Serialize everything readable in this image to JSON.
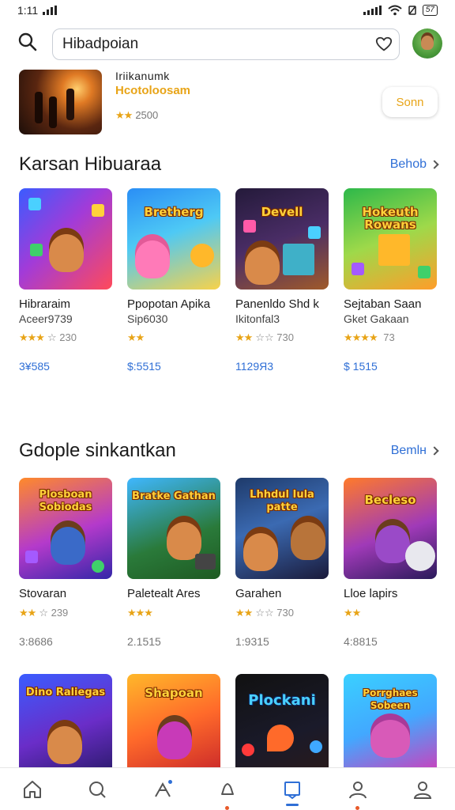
{
  "status_bar": {
    "time": "1:11",
    "battery": "57"
  },
  "search": {
    "value": "Hibadpoian"
  },
  "top_card": {
    "title": "Iriikanumk",
    "subtitle": "Hcotoloosam",
    "stars": "★★",
    "rating": "2500",
    "button_label": "Sonn"
  },
  "sections": [
    {
      "title": "Karsan Hibuaraa",
      "link": "Behob",
      "items": [
        {
          "logo": "",
          "name": "Hibraraim",
          "sub": "Aceer9739",
          "stars": "★★★",
          "empty_stars": "☆",
          "rating": "230",
          "price": "3¥585",
          "price_style": "blue"
        },
        {
          "logo": "Bretherg",
          "name": "Ppopotan Apika",
          "sub": "Sip6030",
          "stars": "★★",
          "empty_stars": "",
          "rating": "",
          "price": "$:5515",
          "price_style": "blue"
        },
        {
          "logo": "Devell",
          "name": "Panenldo Shd k",
          "sub": "Ikitonfal3",
          "stars": "★★",
          "empty_stars": "☆☆",
          "rating": "730",
          "price": "1129Я3",
          "price_style": "blue"
        },
        {
          "logo": "Hokeuth Rowans",
          "name": "Sejtaban Saan",
          "sub": "Gket Gakaan",
          "stars": "★★★★",
          "empty_stars": "",
          "rating": "73",
          "price": "$ 1515",
          "price_style": "blue"
        }
      ]
    },
    {
      "title": "Gdople sinkantkan",
      "link": "Bemlн",
      "items": [
        {
          "logo": "Plosboan Sobiodas",
          "name": "Stovaran",
          "sub": "",
          "stars": "★★",
          "empty_stars": "☆",
          "rating": "239",
          "price": "3:8686",
          "price_style": "gray"
        },
        {
          "logo": "Bratke Gathan",
          "name": "Paletealt Ares",
          "sub": "",
          "stars": "★★★",
          "empty_stars": "",
          "rating": "",
          "price": "2.1515",
          "price_style": "gray"
        },
        {
          "logo": "Lhhdul Iula patte",
          "name": "Garahen",
          "sub": "",
          "stars": "★★",
          "empty_stars": "☆☆",
          "rating": "730",
          "price": "1:9315",
          "price_style": "gray"
        },
        {
          "logo": "Becleso",
          "name": "Lloe lapirs",
          "sub": "",
          "stars": "★★",
          "empty_stars": "",
          "rating": "",
          "price": "4:8815",
          "price_style": "gray"
        }
      ]
    },
    {
      "items": [
        {
          "logo": "Dino Raliegas"
        },
        {
          "logo": "Shapoan"
        },
        {
          "logo": "Plockani"
        },
        {
          "logo": "Porrghaes Sobeen"
        }
      ]
    }
  ],
  "colors": {
    "accent": "#2f6fd6",
    "star": "#e8a417",
    "notify": "#e85a2a"
  },
  "bottom_nav": [
    "home-icon",
    "search-icon",
    "games-icon",
    "bell-icon",
    "library-icon",
    "profile-icon",
    "account-icon"
  ]
}
